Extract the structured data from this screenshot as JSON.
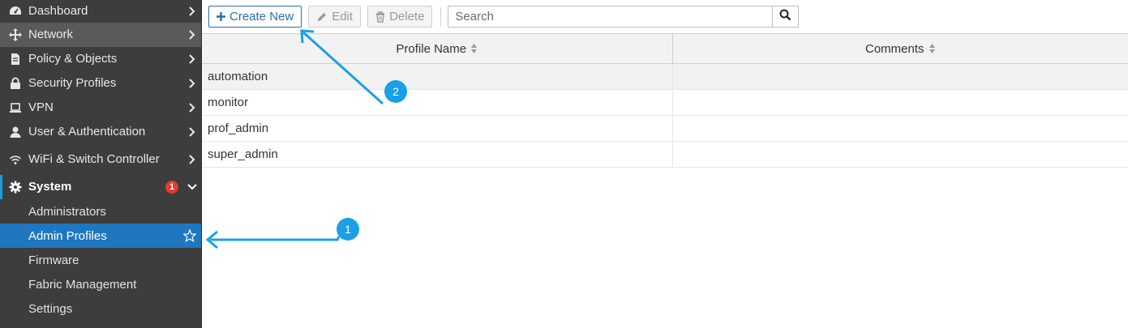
{
  "sidebar": {
    "items": [
      {
        "label": "Dashboard",
        "icon": "dashboard-icon"
      },
      {
        "label": "Network",
        "icon": "network-icon"
      },
      {
        "label": "Policy & Objects",
        "icon": "policy-icon"
      },
      {
        "label": "Security Profiles",
        "icon": "lock-icon"
      },
      {
        "label": "VPN",
        "icon": "laptop-icon"
      },
      {
        "label": "User & Authentication",
        "icon": "user-icon"
      },
      {
        "label": "WiFi & Switch Controller",
        "icon": "wifi-icon"
      },
      {
        "label": "System",
        "icon": "gear-icon",
        "badge": "1"
      }
    ],
    "sub_items": [
      {
        "label": "Administrators"
      },
      {
        "label": "Admin Profiles"
      },
      {
        "label": "Firmware"
      },
      {
        "label": "Fabric Management"
      },
      {
        "label": "Settings"
      }
    ]
  },
  "toolbar": {
    "create_label": "Create New",
    "edit_label": "Edit",
    "delete_label": "Delete",
    "search_placeholder": "Search"
  },
  "table": {
    "columns": [
      "Profile Name",
      "Comments"
    ],
    "rows": [
      [
        "automation",
        ""
      ],
      [
        "monitor",
        ""
      ],
      [
        "prof_admin",
        ""
      ],
      [
        "super_admin",
        ""
      ]
    ]
  },
  "callouts": [
    "1",
    "2"
  ],
  "colors": {
    "sidebar_bg": "#3d3d3d",
    "selected_bg": "#1f77c0",
    "accent": "#1aa0e6",
    "badge": "#e33b2e"
  }
}
